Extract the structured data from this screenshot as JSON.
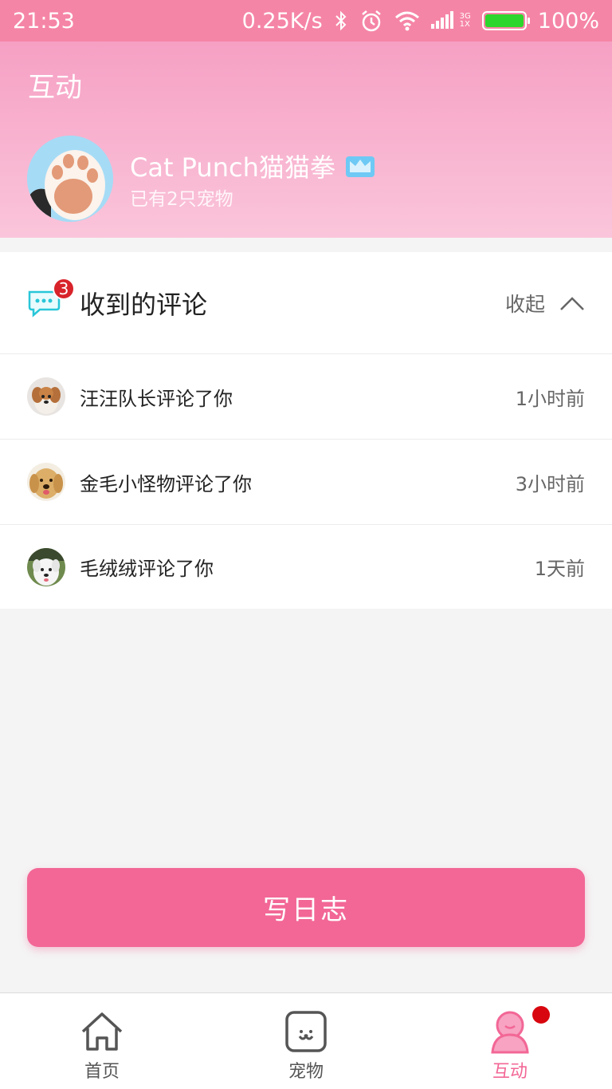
{
  "status_bar": {
    "time": "21:53",
    "net_speed": "0.25K/s",
    "network_tag_top": "3G",
    "network_tag_bottom": "1X",
    "battery_percent": "100%",
    "battery_level": 1.0
  },
  "header": {
    "title": "互动",
    "profile_name": "Cat Punch猫猫拳",
    "profile_sub": "已有2只宠物"
  },
  "comments": {
    "title": "收到的评论",
    "badge_count": "3",
    "collapse_label": "收起",
    "items": [
      {
        "text": "汪汪队长评论了你",
        "time": "1小时前",
        "avatar": "puppy-avatar"
      },
      {
        "text": "金毛小怪物评论了你",
        "time": "3小时前",
        "avatar": "golden-retriever-avatar"
      },
      {
        "text": "毛绒绒评论了你",
        "time": "1天前",
        "avatar": "white-dog-avatar"
      }
    ]
  },
  "write_button": {
    "label": "写日志"
  },
  "nav": {
    "items": [
      {
        "label": "首页",
        "icon": "home-icon"
      },
      {
        "label": "宠物",
        "icon": "pet-icon"
      },
      {
        "label": "互动",
        "icon": "interact-icon"
      }
    ]
  },
  "colors": {
    "accent": "#f26796",
    "status_bar": "#f585a6",
    "header_top": "#f6a0c4",
    "header_bottom": "#fac5da",
    "badge": "#d8232a"
  }
}
